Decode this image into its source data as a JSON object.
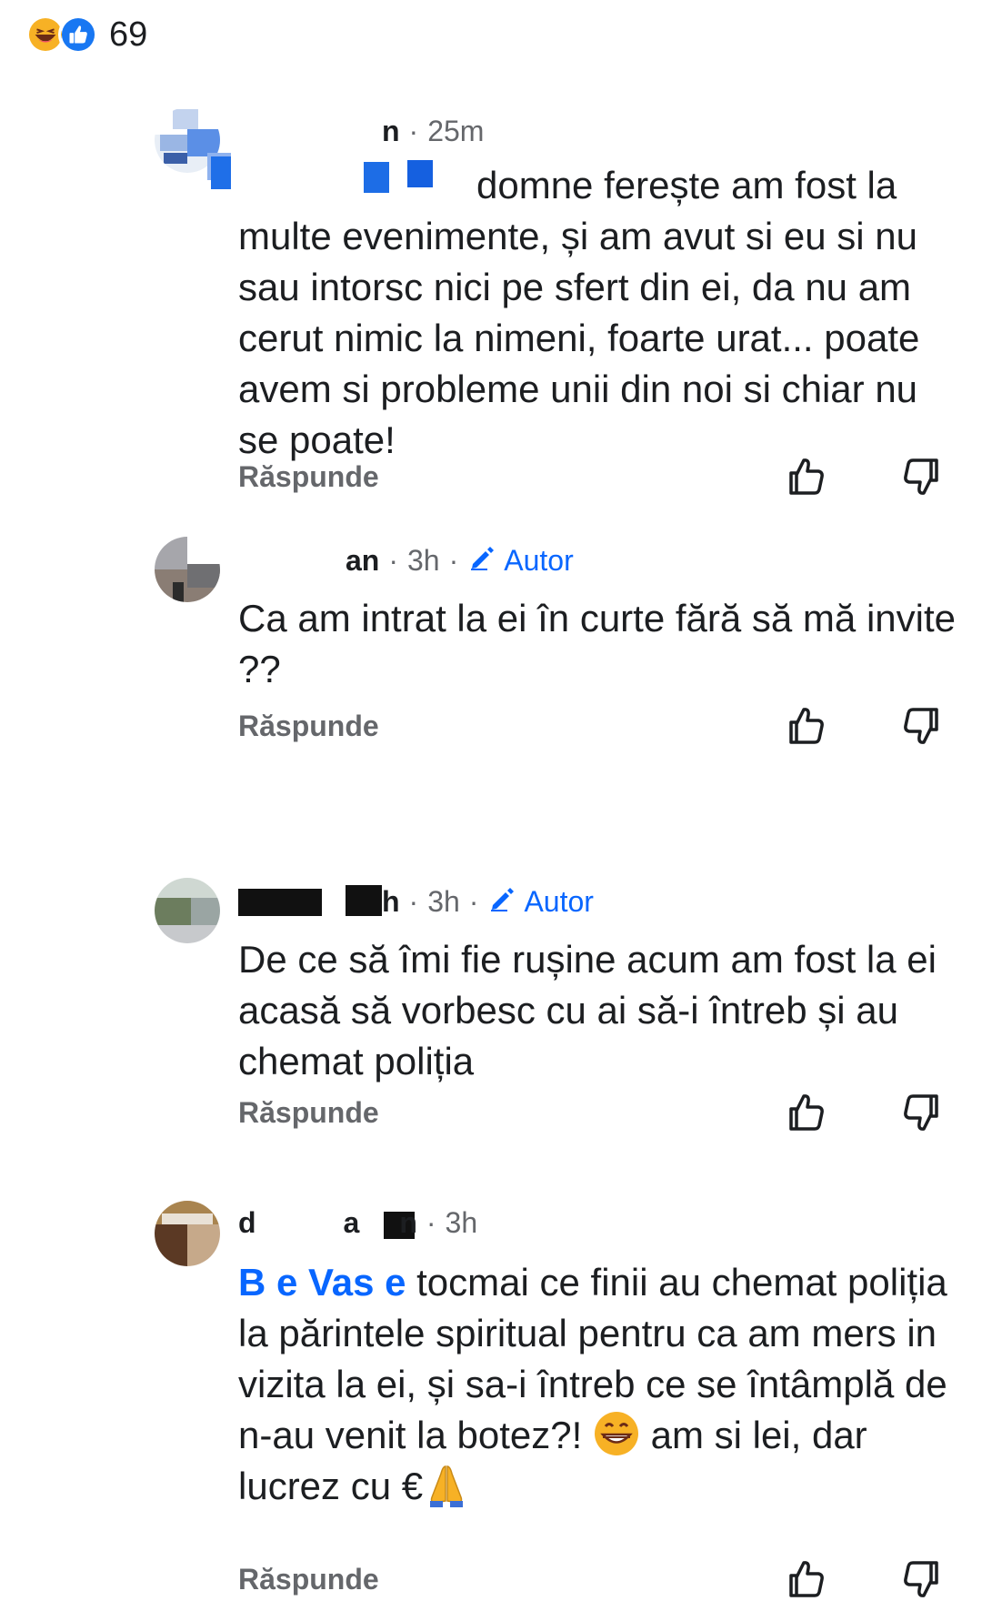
{
  "reactions": {
    "icons": [
      "laughing-face-icon",
      "thumbs-up-icon"
    ],
    "count": "69"
  },
  "comments": [
    {
      "author": "n",
      "time": "25m",
      "badge": "",
      "mention": "",
      "text": "domne ferește am fost la multe evenimente, și am avut si eu si nu sau intorsc nici pe sfert din ei, da nu am cerut nimic la nimeni, foarte urat... poate avem si probleme unii din noi si chiar nu se poate!",
      "reply": "Răspunde"
    },
    {
      "author": "an",
      "time": "3h",
      "badge": "Autor",
      "text": "Ca am intrat la ei în curte fără să mă invite ??",
      "reply": "Răspunde"
    },
    {
      "author": "h",
      "time": "3h",
      "badge": "Autor",
      "text": "De ce să îmi fie rușine acum am fost la ei acasă să vorbesc cu ai să-i întreb și au chemat poliția",
      "reply": "Răspunde"
    },
    {
      "author_parts": [
        "d",
        "a",
        "n"
      ],
      "time": "3h",
      "mention": "B e Vas e",
      "text_a": "tocmai ce finii au chemat poliția la părintele spiritual pentru ca am mers in vizita la ei, și sa-i întreb ce se întâmplă de n-au venit la botez?!",
      "text_b": "am si lei, dar lucrez cu €",
      "emoji_a": "grinning-face-icon",
      "emoji_b": "folded-hands-icon",
      "reply": "Răspunde"
    }
  ],
  "colors": {
    "accent": "#0866ff",
    "meta": "#65676b",
    "text": "#1c1e21"
  }
}
